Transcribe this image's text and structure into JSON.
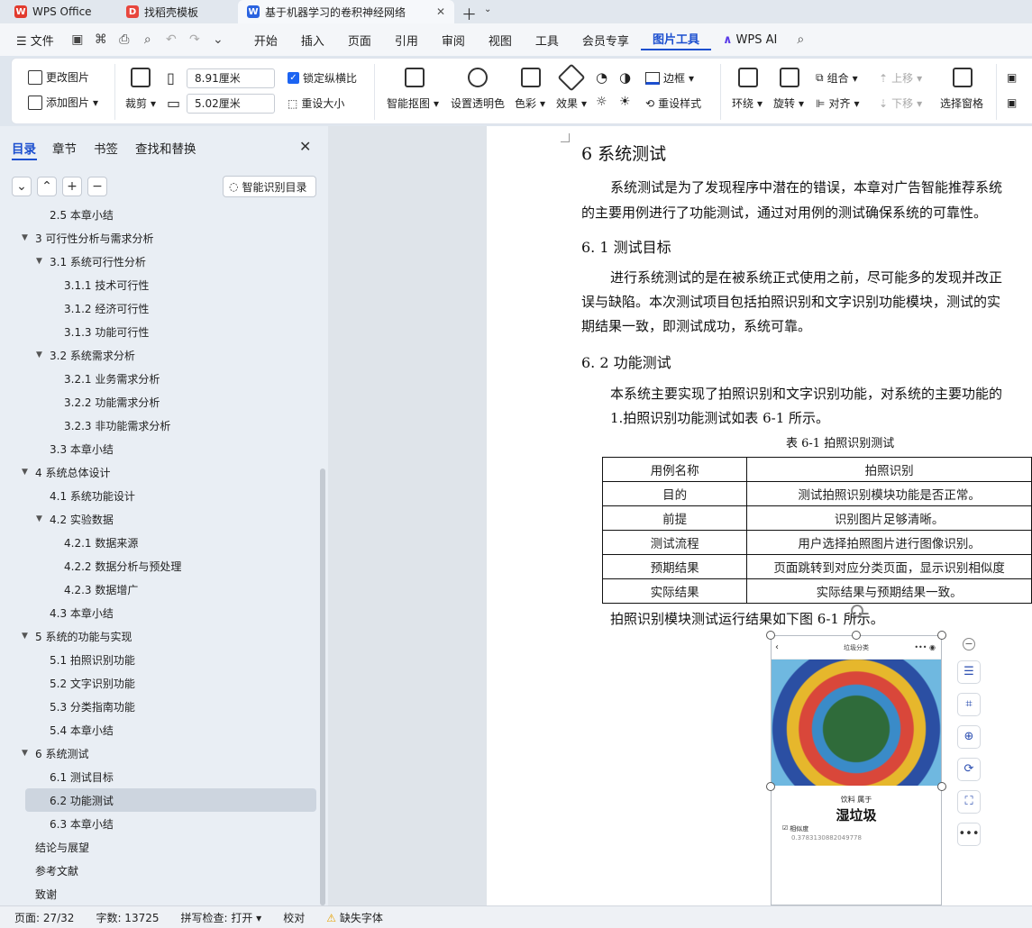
{
  "tabs": [
    {
      "label": "WPS Office"
    },
    {
      "label": "找稻壳模板"
    },
    {
      "label": "基于机器学习的卷积神经网络"
    }
  ],
  "menu": {
    "file": "文件",
    "items": [
      "开始",
      "插入",
      "页面",
      "引用",
      "审阅",
      "视图",
      "工具",
      "会员专享",
      "图片工具"
    ],
    "active": "图片工具",
    "ai": "WPS AI"
  },
  "ribbon": {
    "change_pic": "更改图片",
    "add_pic": "添加图片",
    "crop": "裁剪",
    "width": "8.91厘米",
    "height": "5.02厘米",
    "lock_ratio": "锁定纵横比",
    "reset_size": "重设大小",
    "smart_cut": "智能抠图",
    "transparent": "设置透明色",
    "color": "色彩",
    "effects": "效果",
    "border": "边框",
    "reset_style": "重设样式",
    "wrap": "环绕",
    "rotate": "旋转",
    "group": "组合",
    "align": "对齐",
    "up": "上移",
    "down": "下移",
    "select_pane": "选择窗格"
  },
  "nav": {
    "tabs": [
      "目录",
      "章节",
      "书签",
      "查找和替换"
    ],
    "smart_toc": "智能识别目录",
    "items": [
      {
        "text": "2.5 本章小结",
        "level": 2,
        "arrow": false
      },
      {
        "text": "3 可行性分析与需求分析",
        "level": 1,
        "arrow": true
      },
      {
        "text": "3.1 系统可行性分析",
        "level": 2,
        "arrow": true
      },
      {
        "text": "3.1.1 技术可行性",
        "level": 3,
        "arrow": false
      },
      {
        "text": "3.1.2 经济可行性",
        "level": 3,
        "arrow": false
      },
      {
        "text": "3.1.3 功能可行性",
        "level": 3,
        "arrow": false
      },
      {
        "text": "3.2 系统需求分析",
        "level": 2,
        "arrow": true
      },
      {
        "text": "3.2.1 业务需求分析",
        "level": 3,
        "arrow": false
      },
      {
        "text": "3.2.2 功能需求分析",
        "level": 3,
        "arrow": false
      },
      {
        "text": "3.2.3 非功能需求分析",
        "level": 3,
        "arrow": false
      },
      {
        "text": "3.3 本章小结",
        "level": 2,
        "arrow": false
      },
      {
        "text": "4 系统总体设计",
        "level": 1,
        "arrow": true
      },
      {
        "text": "4.1 系统功能设计",
        "level": 2,
        "arrow": false
      },
      {
        "text": "4.2 实验数据",
        "level": 2,
        "arrow": true
      },
      {
        "text": "4.2.1 数据来源",
        "level": 3,
        "arrow": false
      },
      {
        "text": "4.2.2 数据分析与预处理",
        "level": 3,
        "arrow": false
      },
      {
        "text": "4.2.3 数据增广",
        "level": 3,
        "arrow": false
      },
      {
        "text": "4.3 本章小结",
        "level": 2,
        "arrow": false
      },
      {
        "text": "5 系统的功能与实现",
        "level": 1,
        "arrow": true
      },
      {
        "text": "5.1 拍照识别功能",
        "level": 2,
        "arrow": false
      },
      {
        "text": "5.2 文字识别功能",
        "level": 2,
        "arrow": false
      },
      {
        "text": "5.3 分类指南功能",
        "level": 2,
        "arrow": false
      },
      {
        "text": "5.4 本章小结",
        "level": 2,
        "arrow": false
      },
      {
        "text": "6 系统测试",
        "level": 1,
        "arrow": true
      },
      {
        "text": "6.1 测试目标",
        "level": 2,
        "arrow": false
      },
      {
        "text": "6.2 功能测试",
        "level": 2,
        "arrow": false,
        "selected": true
      },
      {
        "text": "6.3 本章小结",
        "level": 2,
        "arrow": false
      },
      {
        "text": "结论与展望",
        "level": 1,
        "arrow": false
      },
      {
        "text": "参考文献",
        "level": 1,
        "arrow": false
      },
      {
        "text": "致谢",
        "level": 1,
        "arrow": false
      }
    ]
  },
  "doc": {
    "h1": "6  系统测试",
    "p1a": "系统测试是为了发现程序中潜在的错误，本章对广告智能推荐系统",
    "p1b": "的主要用例进行了功能测试，通过对用例的测试确保系统的可靠性。",
    "h2a": "6. 1  测试目标",
    "p2a": "进行系统测试的是在被系统正式使用之前，尽可能多的发现并改正",
    "p2b": "误与缺陷。本次测试项目包括拍照识别和文字识别功能模块，测试的实",
    "p2c": "期结果一致，即测试成功，系统可靠。",
    "h2b": "6. 2  功能测试",
    "p3a": "本系统主要实现了拍照识别和文字识别功能，对系统的主要功能的",
    "p3b": "1.拍照识别功能测试如表 6-1 所示。",
    "caption": "表 6-1  拍照识别测试",
    "table": [
      [
        "用例名称",
        "拍照识别"
      ],
      [
        "目的",
        "测试拍照识别模块功能是否正常。"
      ],
      [
        "前提",
        "识别图片足够清晰。"
      ],
      [
        "测试流程",
        "用户选择拍照图片进行图像识别。"
      ],
      [
        "预期结果",
        "页面跳转到对应分类页面，显示识别相似度"
      ],
      [
        "实际结果",
        "实际结果与预期结果一致。"
      ]
    ],
    "p4": "拍照识别模块测试运行结果如下图 6-1 所示。"
  },
  "phone": {
    "title": "垃圾分类",
    "category_line": "饮料 属于",
    "result": "湿垃圾",
    "sim_label": "相似度",
    "sim_value": "0.3783130882049778"
  },
  "status": {
    "page": "页面: 27/32",
    "words": "字数: 13725",
    "spell": "拼写检查: 打开",
    "proof": "校对",
    "missing_font": "缺失字体"
  }
}
